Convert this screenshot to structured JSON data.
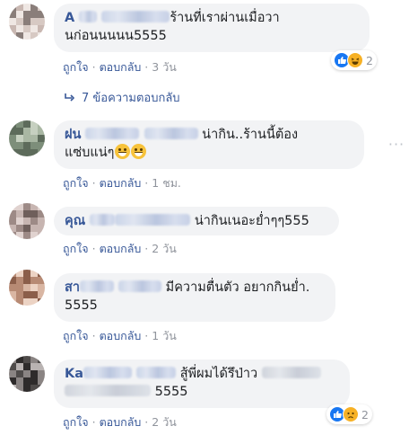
{
  "comments": [
    {
      "text": "ร้านที่เราผ่านเมื่อวา",
      "text2": "นก่อนนนนน5555",
      "author_visible": "A",
      "actions": {
        "like": "ถูกใจ",
        "reply": "ตอบกลับ",
        "time": "3 วัน"
      },
      "reaction_count": "2",
      "replies_label": "7 ข้อความตอบกลับ",
      "avatar_colors": [
        "#c9b8b2",
        "#8a7e7a",
        "#d7c9c3",
        "#efe7e3"
      ]
    },
    {
      "author_visible": "ฝน",
      "text": "น่ากิน..ร้านนี้ต้อง",
      "text2": "แซ่บแน่ๆ",
      "actions": {
        "like": "ถูกใจ",
        "reply": "ตอบกลับ",
        "time": "1 ชม."
      },
      "avatar_colors": [
        "#7d8e7a",
        "#a9b7a3",
        "#5d6b5b",
        "#c6d0c0"
      ]
    },
    {
      "author_visible": "คุณ",
      "text": "น่ากินเนอะย่ำๆๆ555",
      "actions": {
        "like": "ถูกใจ",
        "reply": "ตอบกลับ",
        "time": "2 วัน"
      },
      "avatar_colors": [
        "#9d8a86",
        "#c7b5b1",
        "#6f5f5b",
        "#e0d2cf"
      ]
    },
    {
      "author_visible": "สา",
      "text": "มีความตื่นตัว อยากกินย่ำ.",
      "text2": "5555",
      "actions": {
        "like": "ถูกใจ",
        "reply": "ตอบกลับ",
        "time": "1 วัน"
      },
      "avatar_colors": [
        "#b78a74",
        "#d9b6a3",
        "#8b5e4a",
        "#ecd3c4"
      ]
    },
    {
      "author_visible": "Ka",
      "text": "สู้พี่ผมได้รึป่าว",
      "text2": "5555",
      "actions": {
        "like": "ถูกใจ",
        "reply": "ตอบกลับ",
        "time": "2 วัน"
      },
      "reaction_count": "2",
      "avatar_colors": [
        "#4f4b4a",
        "#8a8483",
        "#2e2b2b",
        "#b9b3b2"
      ]
    }
  ],
  "colors": {
    "link": "#385898",
    "bubble": "#f2f3f5",
    "meta": "#90949c",
    "like": "#1877f2"
  }
}
